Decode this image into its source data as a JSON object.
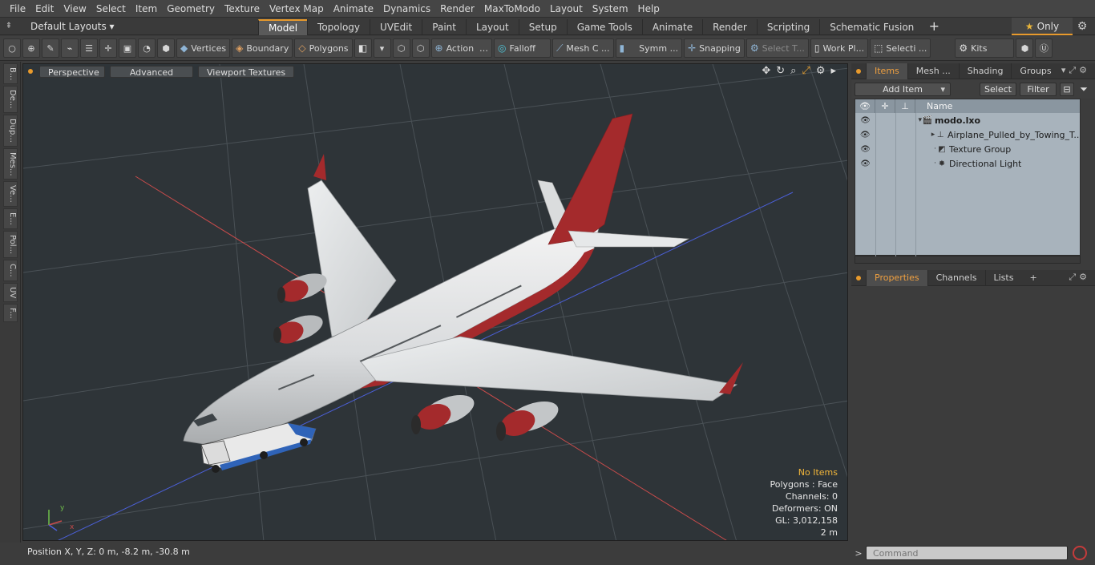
{
  "menu": [
    "File",
    "Edit",
    "View",
    "Select",
    "Item",
    "Geometry",
    "Texture",
    "Vertex Map",
    "Animate",
    "Dynamics",
    "Render",
    "MaxToModo",
    "Layout",
    "System",
    "Help"
  ],
  "layout": {
    "default_label": "Default Layouts ▾",
    "tabs": [
      "Model",
      "Topology",
      "UVEdit",
      "Paint",
      "Layout",
      "Setup",
      "Game Tools",
      "Animate",
      "Render",
      "Scripting",
      "Schematic Fusion"
    ],
    "active_tab": "Model",
    "only_label": "Only"
  },
  "toolbar": {
    "vertices": "Vertices",
    "boundary": "Boundary",
    "polygons": "Polygons",
    "action": "Action",
    "falloff": "Falloff",
    "mesh": "Mesh C ...",
    "symm": "Symm ...",
    "snapping": "Snapping",
    "select_t": "Select T...",
    "work_pl": "Work Pl...",
    "selecti": "Selecti ...",
    "kits": "Kits"
  },
  "left_tabs": [
    "B...",
    "De...",
    "Dup...",
    "Mes...",
    "Ve...",
    "E...",
    "Pol...",
    "C...",
    "UV",
    "F..."
  ],
  "viewport": {
    "perspective": "Perspective",
    "advanced": "Advanced",
    "viewport_textures": "Viewport Textures",
    "stats": {
      "no_items": "No Items",
      "polygons": "Polygons : Face",
      "channels": "Channels: 0",
      "deformers": "Deformers: ON",
      "gl": "GL: 3,012,158",
      "scale": "2 m"
    }
  },
  "status": {
    "position": "Position X, Y, Z:  0 m, -8.2 m, -30.8 m"
  },
  "items_panel": {
    "tabs": [
      "Items",
      "Mesh ...",
      "Shading",
      "Groups"
    ],
    "active_tab": "Items",
    "add_item": "Add Item",
    "select": "Select",
    "filter": "Filter",
    "col_name": "Name",
    "rows": [
      {
        "label": "modo.lxo",
        "indent": 0,
        "icon": "scene-icon",
        "glyph": "🎬"
      },
      {
        "label": "Airplane_Pulled_by_Towing_T...",
        "indent": 1,
        "icon": "locator-icon",
        "glyph": "⊥"
      },
      {
        "label": "Texture Group",
        "indent": 1,
        "icon": "texture-group-icon",
        "glyph": "◩"
      },
      {
        "label": "Directional Light",
        "indent": 1,
        "icon": "light-icon",
        "glyph": "✸"
      }
    ]
  },
  "props_panel": {
    "tabs": [
      "Properties",
      "Channels",
      "Lists"
    ],
    "active_tab": "Properties"
  },
  "command": {
    "placeholder": "Command"
  },
  "colors": {
    "accent": "#e89a2c",
    "tree_bg": "#a8b3bc",
    "livery_red": "#a42a2c"
  }
}
